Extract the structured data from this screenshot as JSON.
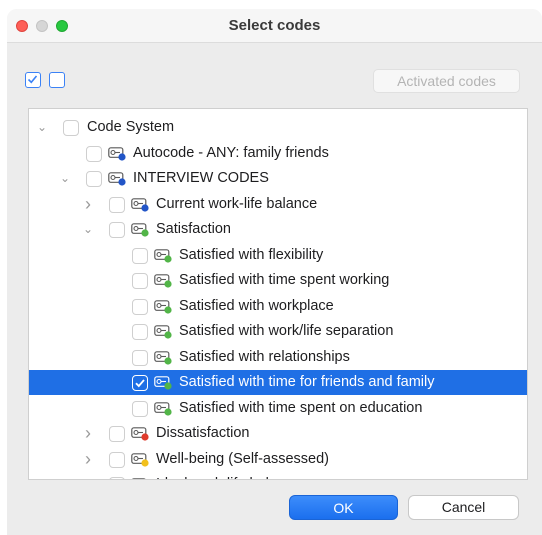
{
  "window": {
    "title": "Select codes"
  },
  "toolbar": {
    "activated_codes_label": "Activated codes"
  },
  "tree": {
    "rows": [
      {
        "label": "Code System",
        "expander": "expanded",
        "checked": false,
        "icon": null,
        "level": 0
      },
      {
        "label": "Autocode - ANY: family  friends",
        "expander": null,
        "checked": false,
        "icon": "code-icon",
        "dot": "#2255c7",
        "level": 1
      },
      {
        "label": "INTERVIEW CODES",
        "expander": "expanded",
        "checked": false,
        "icon": "code-icon",
        "dot": "#2255c7",
        "level": 1
      },
      {
        "label": "Current work-life balance",
        "expander": "collapsed",
        "checked": false,
        "icon": "code-icon",
        "dot": "#2255c7",
        "level": 2
      },
      {
        "label": "Satisfaction",
        "expander": "expanded",
        "checked": false,
        "icon": "code-icon",
        "dot": "#52b548",
        "level": 2
      },
      {
        "label": "Satisfied with flexibility",
        "expander": null,
        "checked": false,
        "icon": "code-icon",
        "dot": "#52b548",
        "level": 3
      },
      {
        "label": "Satisfied with time spent working",
        "expander": null,
        "checked": false,
        "icon": "code-icon",
        "dot": "#52b548",
        "level": 3
      },
      {
        "label": "Satisfied with workplace",
        "expander": null,
        "checked": false,
        "icon": "code-icon",
        "dot": "#52b548",
        "level": 3
      },
      {
        "label": "Satisfied with work/life separation",
        "expander": null,
        "checked": false,
        "icon": "code-icon",
        "dot": "#52b548",
        "level": 3
      },
      {
        "label": "Satisfied with relationships",
        "expander": null,
        "checked": false,
        "icon": "code-icon",
        "dot": "#52b548",
        "level": 3
      },
      {
        "label": "Satisfied with time for friends and family",
        "expander": null,
        "checked": true,
        "icon": "code-icon",
        "dot": "#52b548",
        "level": 3,
        "selected": true
      },
      {
        "label": "Satisfied with time spent on education",
        "expander": null,
        "checked": false,
        "icon": "code-icon",
        "dot": "#52b548",
        "level": 3
      },
      {
        "label": "Dissatisfaction",
        "expander": "collapsed",
        "checked": false,
        "icon": "code-icon",
        "dot": "#e03b2c",
        "level": 2
      },
      {
        "label": "Well-being (Self-assessed)",
        "expander": "collapsed",
        "checked": false,
        "icon": "code-icon",
        "dot": "#f2c01c",
        "level": 2
      },
      {
        "label": "Ideal work-life balance",
        "expander": "collapsed",
        "checked": false,
        "icon": "code-icon",
        "dot": "#2255c7",
        "level": 2
      }
    ]
  },
  "footer": {
    "ok_label": "OK",
    "cancel_label": "Cancel"
  },
  "colors": {
    "accent": "#1f6fe5"
  }
}
